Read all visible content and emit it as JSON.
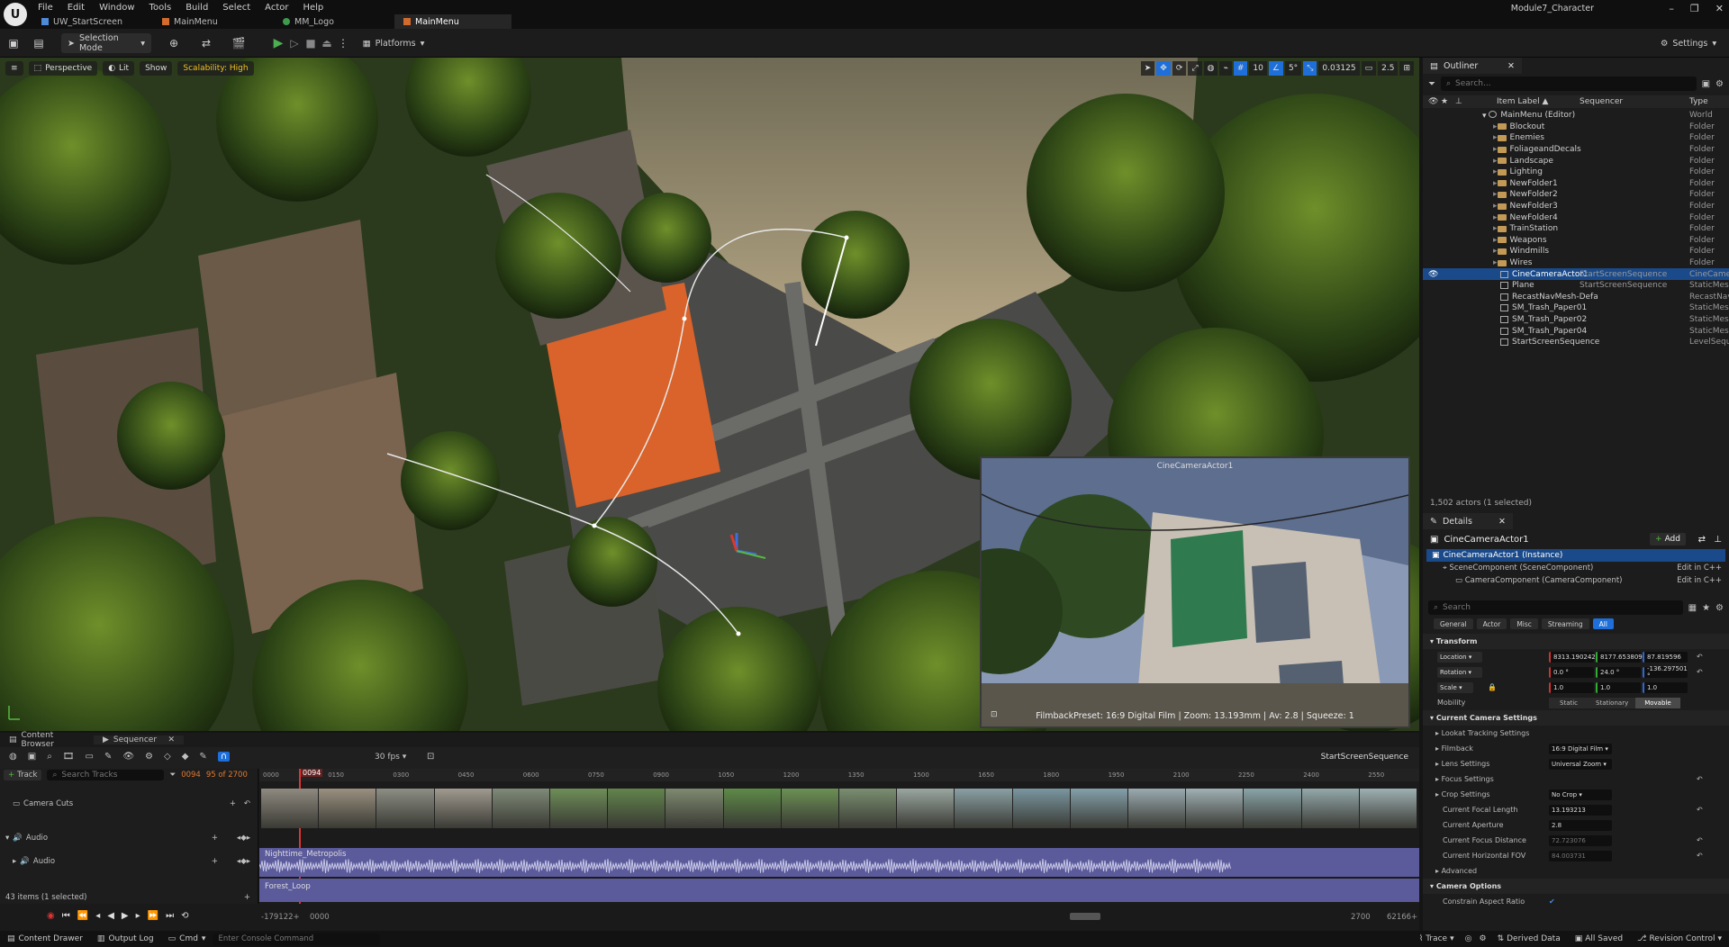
{
  "menu": [
    "File",
    "Edit",
    "Window",
    "Tools",
    "Build",
    "Select",
    "Actor",
    "Help"
  ],
  "tabs": [
    {
      "label": "UW_StartScreen",
      "active": false
    },
    {
      "label": "MainMenu",
      "active": false
    },
    {
      "label": "MM_Logo",
      "active": false
    },
    {
      "label": "MainMenu",
      "active": true
    }
  ],
  "project_name": "Module7_Character",
  "toolbar": {
    "selection_mode": "Selection Mode",
    "platforms": "Platforms",
    "settings": "Settings"
  },
  "viewport": {
    "perspective": "Perspective",
    "lit": "Lit",
    "show": "Show",
    "scalability": "Scalability: High",
    "grid": "10",
    "angle": "5°",
    "scale": "0.03125",
    "speed": "2.5"
  },
  "pip": {
    "title": "CineCameraActor1",
    "info": "FilmbackPreset: 16:9 Digital Film | Zoom: 13.193mm | Av: 2.8 | Squeeze: 1"
  },
  "outliner": {
    "tab": "Outliner",
    "search_placeholder": "Search...",
    "columns": {
      "label": "Item Label ▲",
      "sequencer": "Sequencer",
      "type": "Type"
    },
    "root": {
      "label": "MainMenu (Editor)",
      "type": "World"
    },
    "folders": [
      "Blockout",
      "Enemies",
      "FoliageandDecals",
      "Landscape",
      "Lighting",
      "NewFolder1",
      "NewFolder2",
      "NewFolder3",
      "NewFolder4",
      "TrainStation",
      "Weapons",
      "Windmills",
      "Wires"
    ],
    "folder_type": "Folder",
    "actors": [
      {
        "label": "CineCameraActor1",
        "seq": "StartScreenSequence",
        "type": "CineCamer",
        "sel": true
      },
      {
        "label": "Plane",
        "seq": "StartScreenSequence",
        "type": "StaticMesh",
        "sel": false
      },
      {
        "label": "RecastNavMesh-Defa",
        "seq": "",
        "type": "RecastNav",
        "sel": false
      },
      {
        "label": "SM_Trash_Paper01",
        "seq": "",
        "type": "StaticMesh",
        "sel": false
      },
      {
        "label": "SM_Trash_Paper02",
        "seq": "",
        "type": "StaticMesh",
        "sel": false
      },
      {
        "label": "SM_Trash_Paper04",
        "seq": "",
        "type": "StaticMesh",
        "sel": false
      },
      {
        "label": "StartScreenSequence",
        "seq": "",
        "type": "LevelSequ",
        "sel": false
      }
    ],
    "count": "1,502 actors (1 selected)"
  },
  "details": {
    "tab": "Details",
    "actor": "CineCameraActor1",
    "add": "Add",
    "instance": "CineCameraActor1 (Instance)",
    "components": [
      {
        "label": "SceneComponent (SceneComponent)",
        "edit": "Edit in C++"
      },
      {
        "label": "CameraComponent (CameraComponent)",
        "edit": "Edit in C++"
      }
    ],
    "search_placeholder": "Search",
    "filters": [
      "General",
      "Actor",
      "Misc",
      "Streaming",
      "All"
    ],
    "transform": "Transform",
    "location": {
      "label": "Location",
      "x": "8313.190242",
      "y": "8177.653809",
      "z": "87.819596"
    },
    "rotation": {
      "label": "Rotation",
      "x": "0.0 °",
      "y": "24.0 °",
      "z": "-136.297501 °"
    },
    "scale": {
      "label": "Scale",
      "x": "1.0",
      "y": "1.0",
      "z": "1.0"
    },
    "mobility": {
      "label": "Mobility",
      "options": [
        "Static",
        "Stationary",
        "Movable"
      ]
    },
    "camera_settings": "Current Camera Settings",
    "lookat": "Lookat Tracking Settings",
    "filmback": {
      "label": "Filmback",
      "value": "16:9 Digital Film"
    },
    "lens": {
      "label": "Lens Settings",
      "value": "Universal Zoom"
    },
    "focus": "Focus Settings",
    "crop": {
      "label": "Crop Settings",
      "value": "No Crop"
    },
    "focal": {
      "label": "Current Focal Length",
      "value": "13.193213"
    },
    "aperture": {
      "label": "Current Aperture",
      "value": "2.8"
    },
    "focus_dist": {
      "label": "Current Focus Distance",
      "value": "72.723076"
    },
    "hfov": {
      "label": "Current Horizontal FOV",
      "value": "84.003731"
    },
    "advanced": "Advanced",
    "camera_options": "Camera Options",
    "constrain": "Constrain Aspect Ratio"
  },
  "bottom": {
    "tabs": [
      "Content Browser",
      "Sequencer"
    ],
    "fps": "30 fps",
    "sequence": "StartScreenSequence",
    "track": "Track",
    "search_tracks": "Search Tracks",
    "frame": "0094",
    "frame_of": "95 of 2700",
    "tracks": {
      "camera_cuts": "Camera Cuts",
      "audio": "Audio",
      "audio_sub": "Audio"
    },
    "clips": {
      "a1": "Nighttime_Metropolis",
      "a2": "Forest_Loop"
    },
    "ruler": [
      "0000",
      "0150",
      "0300",
      "0450",
      "0600",
      "0750",
      "0900",
      "1050",
      "1200",
      "1350",
      "1500",
      "1650",
      "1800",
      "1950",
      "2100",
      "2250",
      "2400",
      "2550"
    ],
    "playhead": "0094",
    "items": "43 items (1 selected)",
    "start": "-179122+",
    "start2": "0000",
    "end": "2700",
    "end2": "62166+"
  },
  "status": {
    "drawer": "Content Drawer",
    "output": "Output Log",
    "cmd": "Cmd",
    "console_placeholder": "Enter Console Command",
    "trace": "Trace",
    "derived": "Derived Data",
    "saved": "All Saved",
    "revision": "Revision Control"
  }
}
